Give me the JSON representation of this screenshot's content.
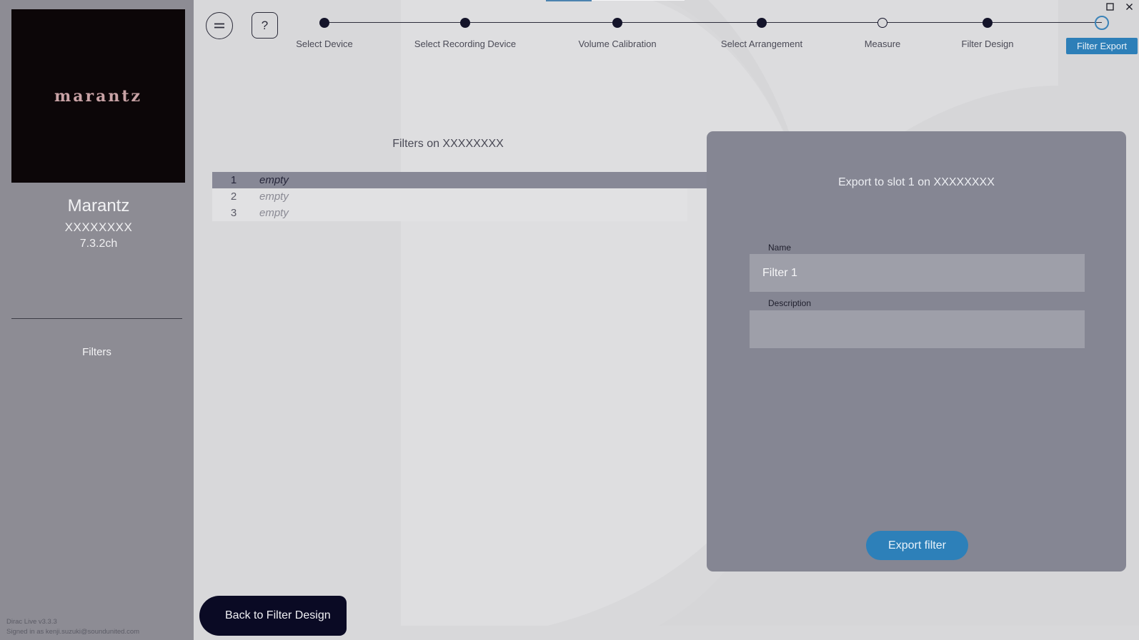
{
  "sidebar": {
    "logo_text": "marantz",
    "brand": "Marantz",
    "model": "XXXXXXXX",
    "channels": "7.3.2ch",
    "nav_filters": "Filters",
    "app_version": "Dirac Live v3.3.3",
    "signed_in": "Signed in as kenji.suzuki@soundunited.com"
  },
  "toolbar": {
    "help_label": "?"
  },
  "stepper": {
    "steps": [
      {
        "label": "Select Device",
        "state": "done"
      },
      {
        "label": "Select Recording Device",
        "state": "done"
      },
      {
        "label": "Volume Calibration",
        "state": "done"
      },
      {
        "label": "Select Arrangement",
        "state": "done"
      },
      {
        "label": "Measure",
        "state": "pending"
      },
      {
        "label": "Filter Design",
        "state": "done"
      },
      {
        "label": "Filter Export",
        "state": "active"
      }
    ]
  },
  "filters_list": {
    "title": "Filters on XXXXXXXX",
    "slots": [
      {
        "number": "1",
        "name": "empty",
        "selected": true
      },
      {
        "number": "2",
        "name": "empty",
        "selected": false
      },
      {
        "number": "3",
        "name": "empty",
        "selected": false
      }
    ]
  },
  "export_panel": {
    "title": "Export to slot 1 on XXXXXXXX",
    "name_label": "Name",
    "name_value": "Filter 1",
    "description_label": "Description",
    "description_value": "",
    "export_button": "Export filter"
  },
  "footer": {
    "back_button": "Back to Filter Design"
  },
  "colors": {
    "accent": "#2d80b9",
    "sidebar_bg": "#8d8c94",
    "panel_bg": "#858693",
    "back_button_bg": "#0a0a24"
  }
}
